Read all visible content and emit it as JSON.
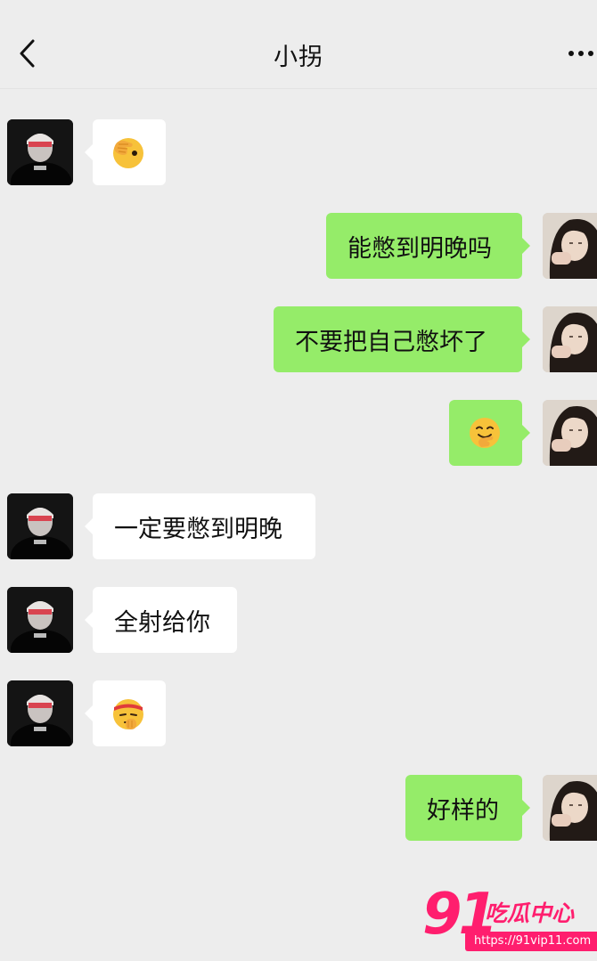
{
  "header": {
    "title": "小拐",
    "back_icon": "chevron-left-icon",
    "more_icon": "more-dots-icon"
  },
  "messages": [
    {
      "side": "in",
      "type": "emoji",
      "emoji": "facepalm-peek-emoji"
    },
    {
      "side": "out",
      "type": "text",
      "text": "能憋到明晚吗"
    },
    {
      "side": "out",
      "type": "text",
      "text": "不要把自己憋坏了"
    },
    {
      "side": "out",
      "type": "emoji",
      "emoji": "grinning-hand-over-mouth-emoji"
    },
    {
      "side": "in",
      "type": "text",
      "text": "一定要憋到明晚"
    },
    {
      "side": "in",
      "type": "text",
      "text": "全射给你"
    },
    {
      "side": "in",
      "type": "emoji",
      "emoji": "headband-fist-emoji"
    },
    {
      "side": "out",
      "type": "text",
      "text": "好样的"
    }
  ],
  "watermark": {
    "number": "91",
    "name": "吃瓜中心",
    "url": "https://91vip11.com"
  },
  "colors": {
    "background": "#ededed",
    "incoming_bubble": "#ffffff",
    "outgoing_bubble": "#95ec69",
    "watermark": "#ff1e6e"
  }
}
